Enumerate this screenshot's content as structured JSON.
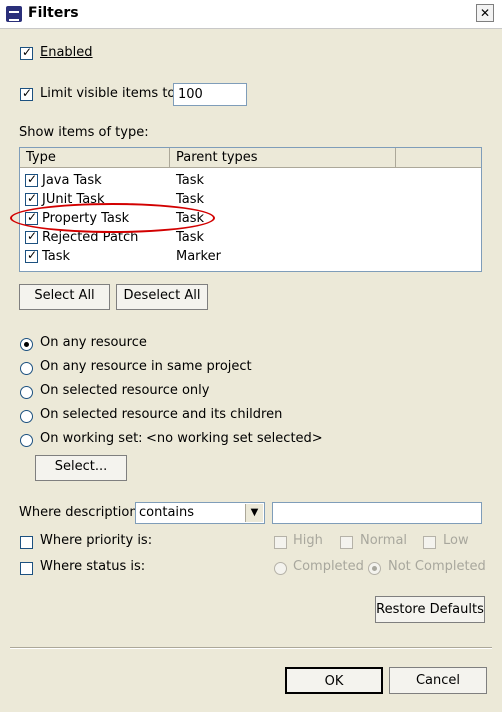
{
  "window": {
    "title": "Filters",
    "close_symbol": "✕"
  },
  "enabled": {
    "label": "Enabled",
    "checked": true
  },
  "limit": {
    "label": "Limit visible items to:",
    "value": "100",
    "checked": true
  },
  "types_section": {
    "label": "Show items of type:",
    "columns": [
      "Type",
      "Parent types"
    ],
    "rows": [
      {
        "type": "Java Task",
        "parent": "Task",
        "checked": true
      },
      {
        "type": "JUnit Task",
        "parent": "Task",
        "checked": true
      },
      {
        "type": "Property Task",
        "parent": "Task",
        "checked": true
      },
      {
        "type": "Rejected Patch",
        "parent": "Task",
        "checked": true
      },
      {
        "type": "Task",
        "parent": "Marker",
        "checked": true
      }
    ],
    "select_all": "Select All",
    "deselect_all": "Deselect All"
  },
  "resource_scope": {
    "options": [
      "On any resource",
      "On any resource in same project",
      "On selected resource only",
      "On selected resource and its children",
      "On working set:"
    ],
    "selected_index": 0,
    "working_set_value": "<no working set selected>",
    "select_button": "Select..."
  },
  "description": {
    "label": "Where description",
    "operator": "contains",
    "value": ""
  },
  "priority": {
    "label": "Where priority is:",
    "options": [
      "High",
      "Normal",
      "Low"
    ]
  },
  "status": {
    "label": "Where status is:",
    "options": [
      "Completed",
      "Not Completed"
    ],
    "selected": "Not Completed"
  },
  "restore_defaults": "Restore Defaults",
  "footer": {
    "ok": "OK",
    "cancel": "Cancel"
  }
}
